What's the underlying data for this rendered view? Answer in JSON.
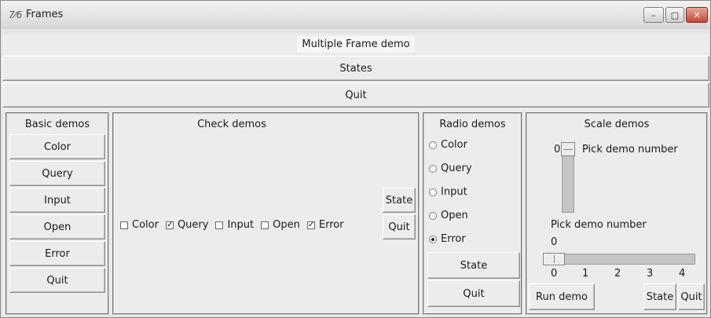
{
  "window": {
    "title": "Frames",
    "icon": "feather-icon",
    "controls": {
      "minimize": "–",
      "maximize": "□",
      "close": "✕"
    }
  },
  "header": {
    "title": "Multiple Frame demo",
    "states_button": "States",
    "quit_button": "Quit"
  },
  "basic": {
    "title": "Basic demos",
    "buttons": [
      "Color",
      "Query",
      "Input",
      "Open",
      "Error",
      "Quit"
    ]
  },
  "check": {
    "title": "Check demos",
    "items": [
      {
        "label": "Color",
        "checked": false,
        "mark": ""
      },
      {
        "label": "Query",
        "checked": true,
        "mark": "✓"
      },
      {
        "label": "Input",
        "checked": false,
        "mark": ""
      },
      {
        "label": "Open",
        "checked": false,
        "mark": ""
      },
      {
        "label": "Error",
        "checked": true,
        "mark": "✓"
      }
    ],
    "state_button": "State",
    "quit_button": "Quit"
  },
  "radio": {
    "title": "Radio demos",
    "options": [
      "Color",
      "Query",
      "Input",
      "Open",
      "Error"
    ],
    "selected": "Error",
    "state_button": "State",
    "quit_button": "Quit"
  },
  "scale": {
    "title": "Scale demos",
    "vertical": {
      "value": "0",
      "label": "Pick demo number"
    },
    "horizontal": {
      "label": "Pick demo number",
      "value": "0",
      "ticks": [
        "0",
        "1",
        "2",
        "3",
        "4"
      ]
    },
    "run_button": "Run demo",
    "state_button": "State",
    "quit_button": "Quit"
  }
}
